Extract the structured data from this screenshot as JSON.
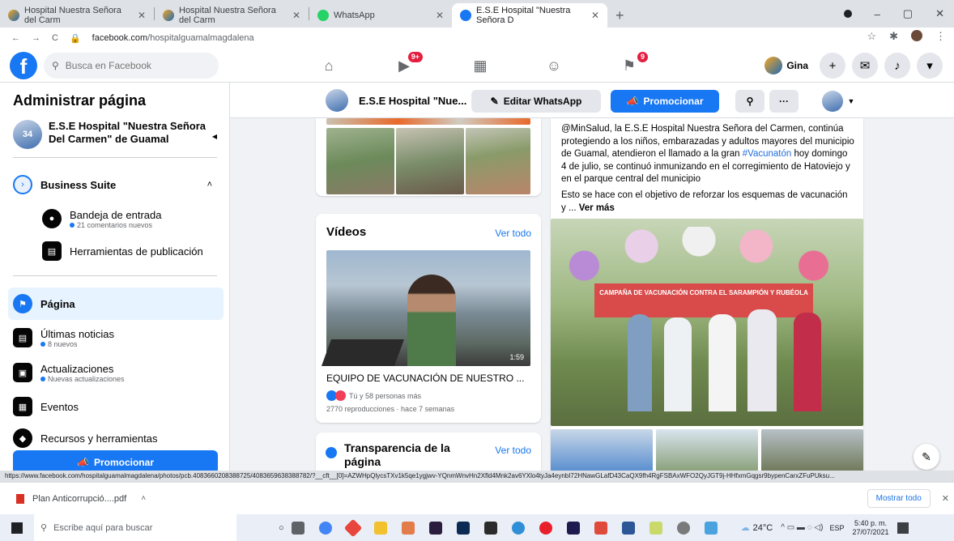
{
  "browser": {
    "tabs": [
      {
        "title": "Hospital Nuestra Señora del Carm",
        "active": false
      },
      {
        "title": "Hospital Nuestra Señora del Carm",
        "active": false
      },
      {
        "title": "WhatsApp",
        "active": false
      },
      {
        "title": "E.S.E Hospital \"Nuestra Señora D",
        "active": true
      }
    ],
    "new_tab": "+",
    "url_host": "facebook.com",
    "url_path": "/hospitalguamalmagdalena",
    "window": {
      "minimize": "–",
      "maximize": "▢",
      "close": "✕"
    }
  },
  "fb_nav": {
    "logo": "f",
    "search_placeholder": "Busca en Facebook",
    "watch_badge": "9+",
    "pages_badge": "9",
    "user_name": "Gina"
  },
  "sidebar": {
    "title": "Administrar página",
    "page_name": "E.S.E Hospital \"Nuestra Señora Del Carmen\" de Guamal",
    "page_avatar_text": "34",
    "business_suite": "Business Suite",
    "inbox": {
      "label": "Bandeja de entrada",
      "sub": "21 comentarios nuevos"
    },
    "publishing_tools": "Herramientas de publicación",
    "pagina": "Página",
    "news": {
      "label": "Últimas noticias",
      "sub": "8 nuevos"
    },
    "updates": {
      "label": "Actualizaciones",
      "sub": "Nuevas actualizaciones"
    },
    "events": "Eventos",
    "resources": "Recursos y herramientas",
    "promote_button": "Promocionar"
  },
  "page_header": {
    "name": "E.S.E Hospital \"Nue...",
    "edit_whatsapp": "Editar WhatsApp",
    "promote": "Promocionar",
    "more": "···"
  },
  "videos": {
    "title": "Vídeos",
    "see_all": "Ver todo",
    "duration": "1:59",
    "video_title": "EQUIPO DE VACUNACIÓN DE NUESTRO ...",
    "reactions": "Tú y 58 personas más",
    "meta": "2770 reproducciones · hace 7 semanas"
  },
  "transparency": {
    "title": "Transparencia de la página",
    "see_all": "Ver todo"
  },
  "post": {
    "line1": "@MinSalud, la E.S.E Hospital Nuestra Señora del Carmen, continúa protegiendo a los niños, embarazadas y adultos mayores del municipio de Guamal, atendieron el llamado a la gran ",
    "hashtag": "#Vacunatón",
    "line2": " hoy domingo 4 de julio, se continuó inmunizando en el corregimiento de Hatoviejo y en el parque central del municipio",
    "line3": "Esto se hace con el objetivo de reforzar los esquemas de vacunación y ...",
    "see_more": "Ver más",
    "banner_text": "CAMPAÑA DE VACUNACIÓN CONTRA EL SARAMPIÓN Y RUBÉOLA"
  },
  "status_url": "https://www.facebook.com/hospitalguamalmagdalena/photos/pcb.4083660208388725/4083659638388782/?__cft__[0]=AZWHpQlycsTXv1k5qe1ygjwv-YQnmWnvHn2Xfld4Mnk2av6YXlo4tyJa4eynbI72HNawGLafD43CaQX9fh4RgFSBAxWFO2QyJGT9j-HHfxmGqgsr9bypenCarxZFuPUksu...",
  "download": {
    "file": "Plan Anticorrupció....pdf",
    "show_all": "Mostrar todo"
  },
  "taskbar": {
    "search_placeholder": "Escribe aquí para buscar",
    "weather": "24°C",
    "lang": "ESP",
    "time": "5:40 p. m.",
    "date": "27/07/2021"
  }
}
